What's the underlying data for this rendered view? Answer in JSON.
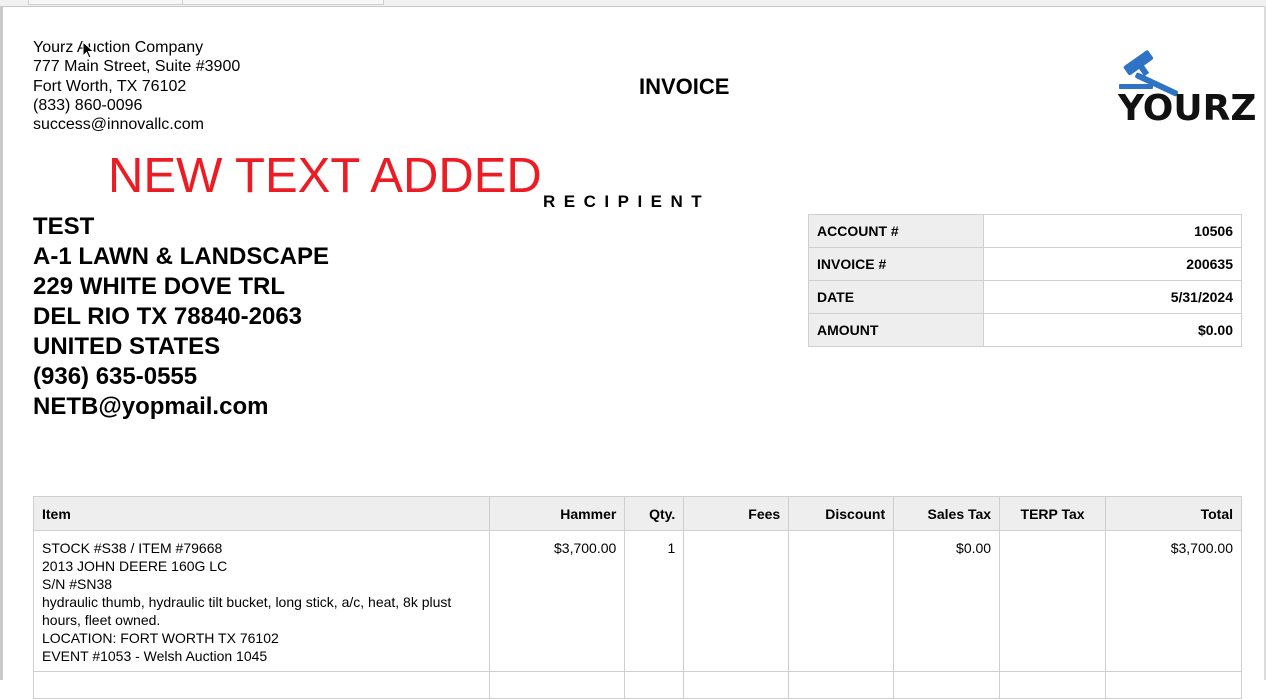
{
  "company": {
    "name": "Yourz Auction Company",
    "address_line1": "777 Main Street, Suite #3900",
    "address_line2": "Fort Worth, TX 76102",
    "phone": "(833) 860-0096",
    "email": "success@innovallc.com"
  },
  "document": {
    "title": "INVOICE",
    "logo_text": "YOURZ",
    "added_text": "NEW TEXT ADDED",
    "recipient_label": "RECIPIENT"
  },
  "recipient": {
    "name": "TEST",
    "business": "A-1 LAWN & LANDSCAPE",
    "street": "229 WHITE DOVE TRL",
    "city_state_zip": "DEL RIO TX 78840-2063",
    "country": "UNITED STATES",
    "phone": "(936) 635-0555",
    "email": "NETB@yopmail.com"
  },
  "summary": [
    {
      "label": "ACCOUNT #",
      "value": "10506"
    },
    {
      "label": "INVOICE #",
      "value": "200635"
    },
    {
      "label": "DATE",
      "value": "5/31/2024"
    },
    {
      "label": "AMOUNT",
      "value": "$0.00"
    }
  ],
  "items_table": {
    "headers": {
      "item": "Item",
      "hammer": "Hammer",
      "qty": "Qty.",
      "fees": "Fees",
      "discount": "Discount",
      "sales_tax": "Sales Tax",
      "terp_tax": "TERP Tax",
      "total": "Total"
    },
    "rows": [
      {
        "stock": "STOCK #S38 / ITEM #79668",
        "model": "2013 JOHN DEERE 160G LC",
        "serial": "S/N #SN38",
        "details": "hydraulic thumb, hydraulic tilt bucket, long stick, a/c, heat, 8k plust hours, fleet owned.",
        "location": "LOCATION: FORT WORTH TX 76102",
        "event": "EVENT #1053 - Welsh Auction 1045",
        "hammer": "$3,700.00",
        "qty": "1",
        "fees": "",
        "discount": "",
        "sales_tax": "$0.00",
        "terp_tax": "",
        "total": "$3,700.00"
      }
    ]
  },
  "colors": {
    "added_text": "#ec1c24",
    "logo_blue": "#2f73c4",
    "header_bg": "#eeeeee"
  }
}
